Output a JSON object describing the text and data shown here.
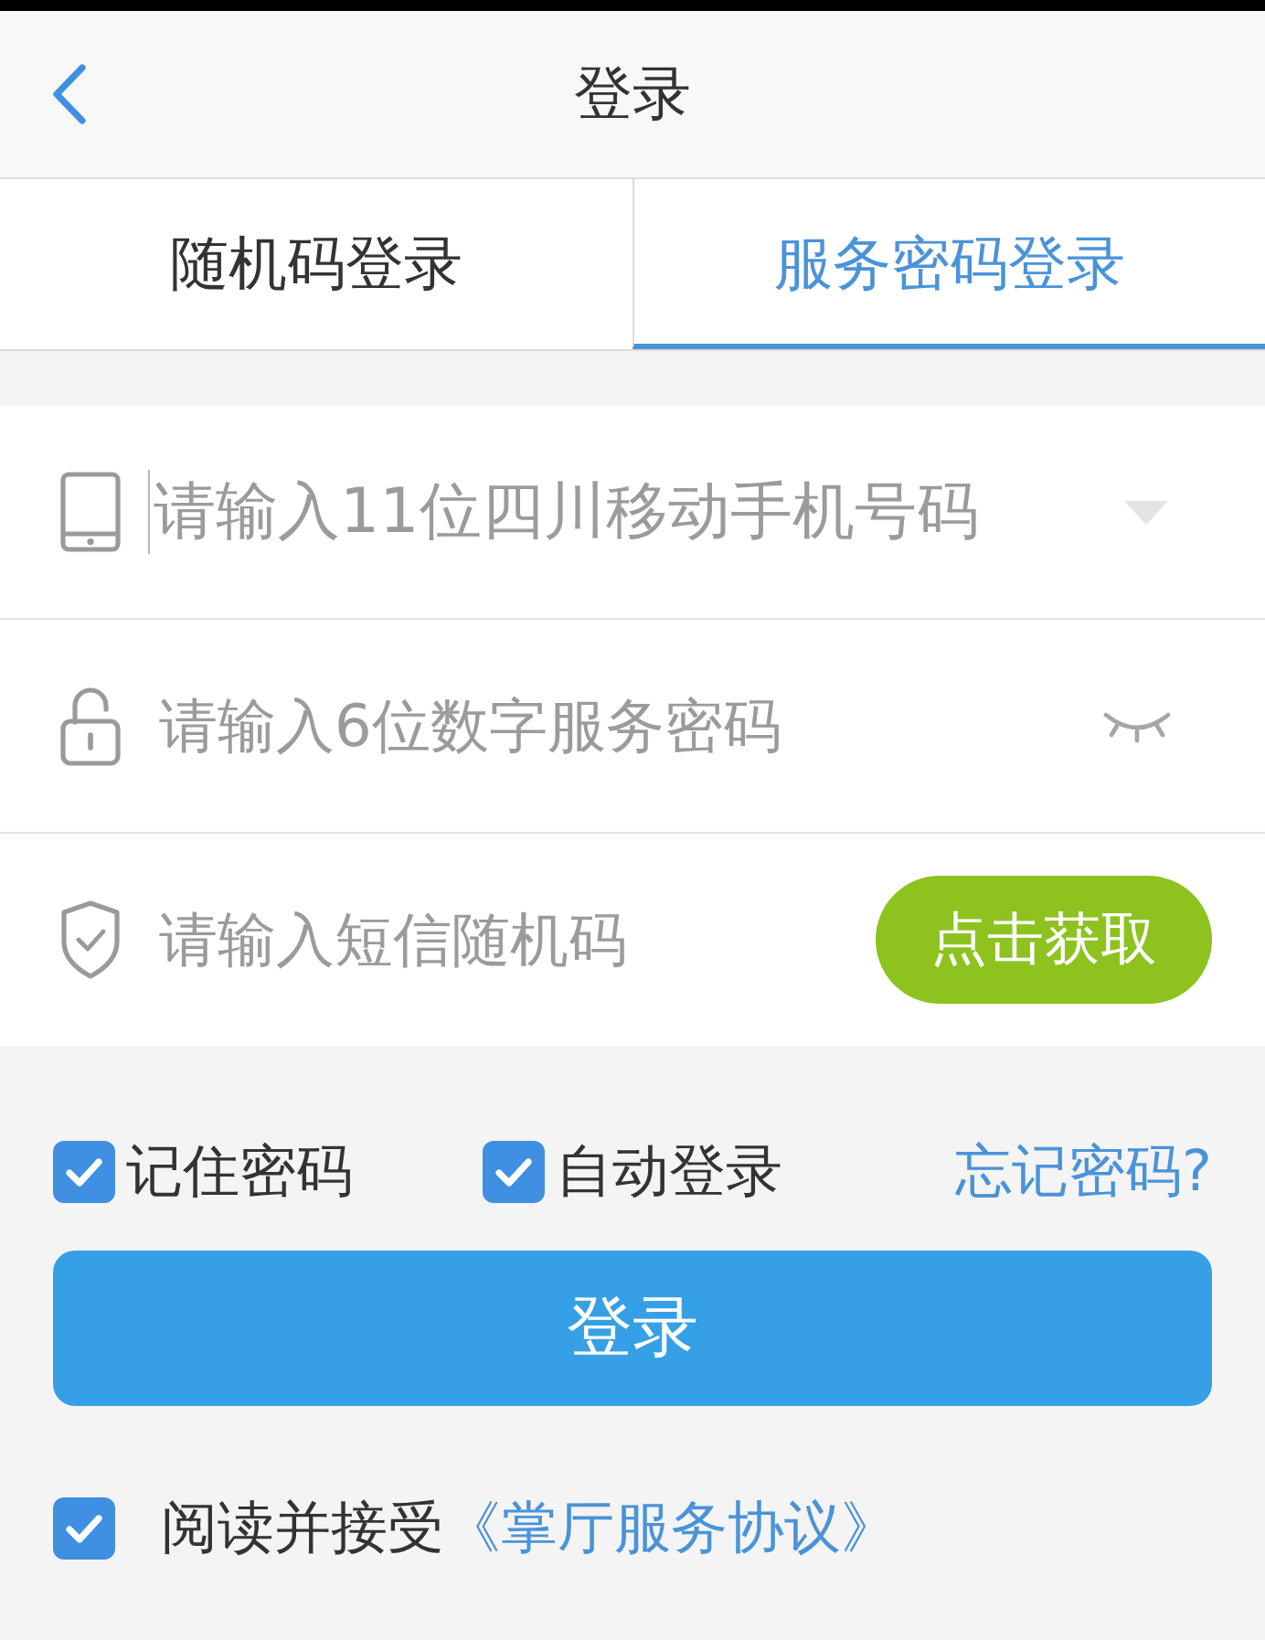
{
  "header": {
    "title": "登录"
  },
  "tabs": [
    {
      "label": "随机码登录",
      "selected": false
    },
    {
      "label": "服务密码登录",
      "selected": true
    }
  ],
  "fields": [
    {
      "kind": "phone",
      "placeholder": "请输入11位四川移动手机号码",
      "focused": true
    },
    {
      "kind": "password",
      "placeholder": "请输入6位数字服务密码",
      "focused": false
    },
    {
      "kind": "sms",
      "placeholder": "请输入短信随机码",
      "focused": false,
      "button": "点击获取"
    }
  ],
  "options": [
    {
      "label": "记住密码",
      "checked": true
    },
    {
      "label": "自动登录",
      "checked": true
    }
  ],
  "forgot_link": "忘记密码?",
  "login_button": "登录",
  "agreement": {
    "checked": true,
    "text": "阅读并接受",
    "link": "《掌厅服务协议》"
  }
}
